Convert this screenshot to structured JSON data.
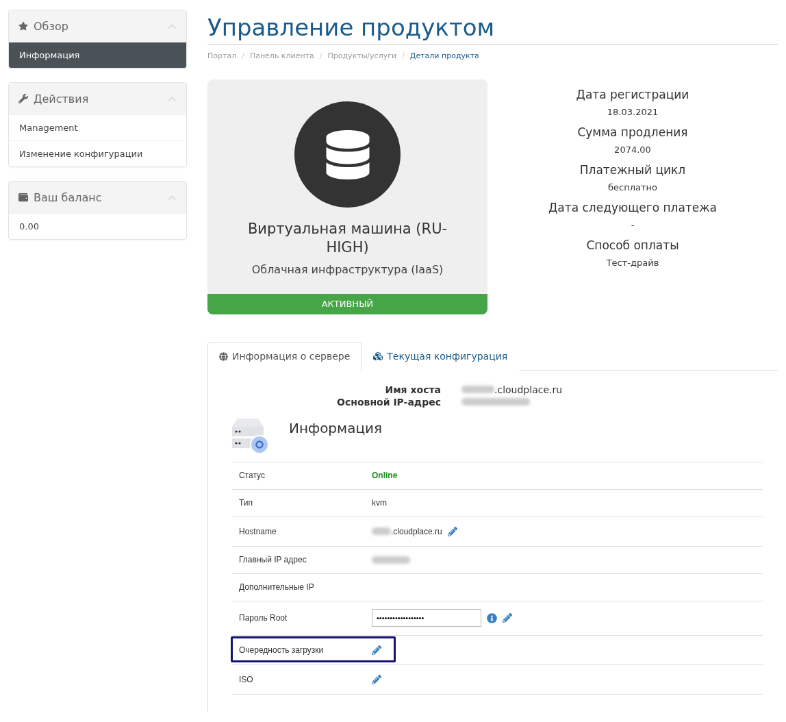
{
  "sidebar": {
    "panels": [
      {
        "kind": "overview",
        "title": "Обзор",
        "expanded": true,
        "items": [
          {
            "label": "Информация",
            "selected": true
          }
        ]
      },
      {
        "kind": "actions",
        "title": "Действия",
        "expanded": true,
        "items": [
          {
            "label": "Management",
            "selected": false
          },
          {
            "label": "Изменение конфигурации",
            "selected": false
          }
        ]
      },
      {
        "kind": "balance",
        "title": "Ваш баланс",
        "expanded": true,
        "items": [
          {
            "label": "0.00",
            "selected": false
          }
        ]
      }
    ]
  },
  "page": {
    "title": "Управление продуктом",
    "separator": "/",
    "breadcrumbs": [
      {
        "label": "Портал",
        "selected": false
      },
      {
        "label": "Панель клиента",
        "selected": false
      },
      {
        "label": "Продукты/услуги",
        "selected": false
      },
      {
        "label": "Детали продукта",
        "selected": true
      }
    ]
  },
  "product": {
    "name": "Виртуальная машина (RU-HIGH)",
    "group": "Облачная инфраструктура (IaaS)",
    "status": "АКТИВНЫЙ",
    "color": "#46a546"
  },
  "details": [
    {
      "label": "Дата регистрации",
      "value": "18.03.2021"
    },
    {
      "label": "Сумма продления",
      "value": "2074.00"
    },
    {
      "label": "Платежный цикл",
      "value": "бесплатно"
    },
    {
      "label": "Дата следующего платежа",
      "value": "-"
    },
    {
      "label": "Способ оплаты",
      "value": "Тест-драйв"
    }
  ],
  "tabs": [
    {
      "kind": "globe",
      "label": "Информация о сервере",
      "selected": true
    },
    {
      "kind": "cubes",
      "label": "Текущая конфигурация",
      "selected": false
    }
  ],
  "server": {
    "summary": [
      {
        "label": "Имя хоста",
        "value": ".cloudplace.ru",
        "blurred": true
      },
      {
        "label": "Основной IP-адрес",
        "blurred": true
      }
    ],
    "heading": "Информация",
    "rows": [
      {
        "kind": "text",
        "label": "Статус",
        "value": "Online",
        "color": "#1a8c1a",
        "highlighted": false
      },
      {
        "kind": "text",
        "label": "Тип",
        "value": "kvm",
        "highlighted": false
      },
      {
        "kind": "edit",
        "label": "Hostname",
        "value": ".cloudplace.ru",
        "blurred": true,
        "highlighted": false
      },
      {
        "kind": "text",
        "label": "Главный IP адрес",
        "blurred": true,
        "highlighted": false
      },
      {
        "kind": "text",
        "label": "Дополнительные IP",
        "highlighted": false
      },
      {
        "kind": "password",
        "label": "Пароль Root",
        "value": "••••••••••••••••••",
        "highlighted": false
      },
      {
        "kind": "edit",
        "label": "Очередность загрузки",
        "highlighted": true
      },
      {
        "kind": "edit",
        "label": "ISO",
        "highlighted": false
      }
    ]
  }
}
